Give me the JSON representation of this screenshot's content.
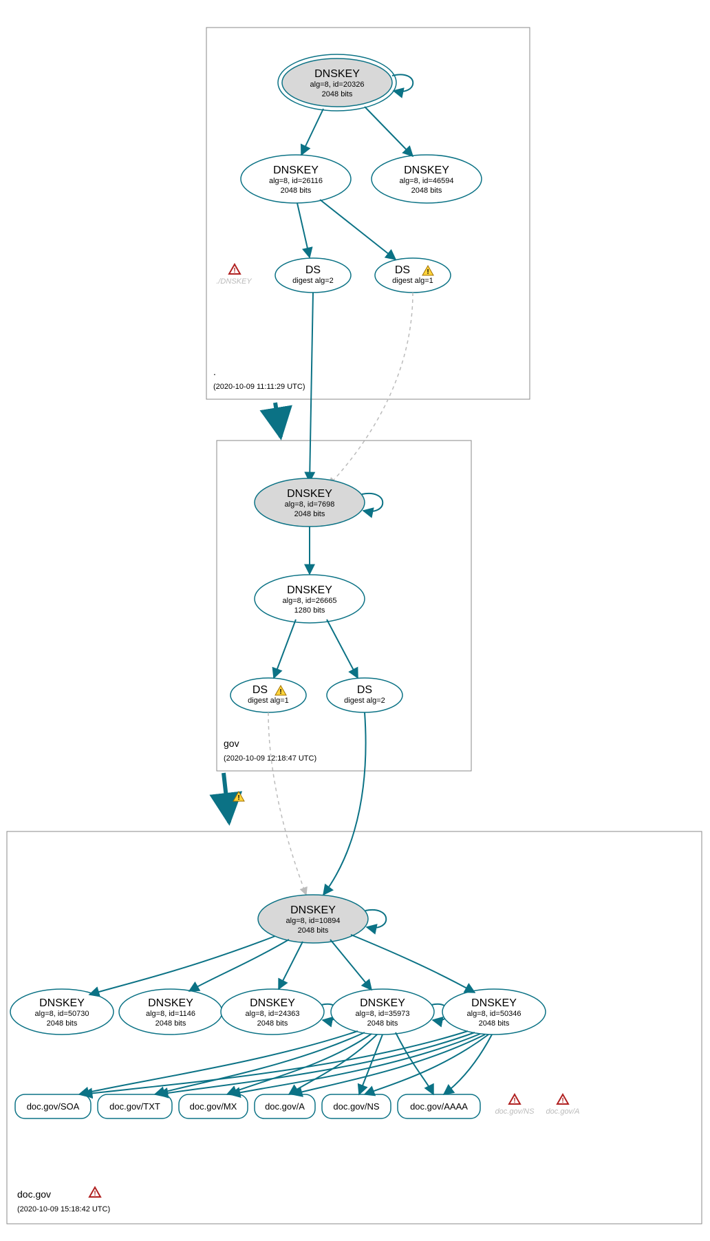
{
  "zones": {
    "root": {
      "label": ".",
      "timestamp": "(2020-10-09 11:11:29 UTC)"
    },
    "gov": {
      "label": "gov",
      "timestamp": "(2020-10-09 12:18:47 UTC)"
    },
    "docgov": {
      "label": "doc.gov",
      "timestamp": "(2020-10-09 15:18:42 UTC)"
    }
  },
  "nodes": {
    "root_ksk": {
      "title": "DNSKEY",
      "sub1": "alg=8, id=20326",
      "sub2": "2048 bits"
    },
    "root_zsk1": {
      "title": "DNSKEY",
      "sub1": "alg=8, id=26116",
      "sub2": "2048 bits"
    },
    "root_zsk2": {
      "title": "DNSKEY",
      "sub1": "alg=8, id=46594",
      "sub2": "2048 bits"
    },
    "root_ds2": {
      "title": "DS",
      "sub1": "digest alg=2"
    },
    "root_ds1": {
      "title": "DS",
      "sub1": "digest alg=1"
    },
    "root_ghost": {
      "label": "./DNSKEY"
    },
    "gov_ksk": {
      "title": "DNSKEY",
      "sub1": "alg=8, id=7698",
      "sub2": "2048 bits"
    },
    "gov_zsk": {
      "title": "DNSKEY",
      "sub1": "alg=8, id=26665",
      "sub2": "1280 bits"
    },
    "gov_ds1": {
      "title": "DS",
      "sub1": "digest alg=1"
    },
    "gov_ds2": {
      "title": "DS",
      "sub1": "digest alg=2"
    },
    "doc_ksk": {
      "title": "DNSKEY",
      "sub1": "alg=8, id=10894",
      "sub2": "2048 bits"
    },
    "doc_k1": {
      "title": "DNSKEY",
      "sub1": "alg=8, id=50730",
      "sub2": "2048 bits"
    },
    "doc_k2": {
      "title": "DNSKEY",
      "sub1": "alg=8, id=1146",
      "sub2": "2048 bits"
    },
    "doc_k3": {
      "title": "DNSKEY",
      "sub1": "alg=8, id=24363",
      "sub2": "2048 bits"
    },
    "doc_k4": {
      "title": "DNSKEY",
      "sub1": "alg=8, id=35973",
      "sub2": "2048 bits"
    },
    "doc_k5": {
      "title": "DNSKEY",
      "sub1": "alg=8, id=50346",
      "sub2": "2048 bits"
    },
    "rr_soa": {
      "label": "doc.gov/SOA"
    },
    "rr_txt": {
      "label": "doc.gov/TXT"
    },
    "rr_mx": {
      "label": "doc.gov/MX"
    },
    "rr_a": {
      "label": "doc.gov/A"
    },
    "rr_ns": {
      "label": "doc.gov/NS"
    },
    "rr_aaaa": {
      "label": "doc.gov/AAAA"
    },
    "rr_ns_ghost": {
      "label": "doc.gov/NS"
    },
    "rr_a_ghost": {
      "label": "doc.gov/A"
    }
  }
}
